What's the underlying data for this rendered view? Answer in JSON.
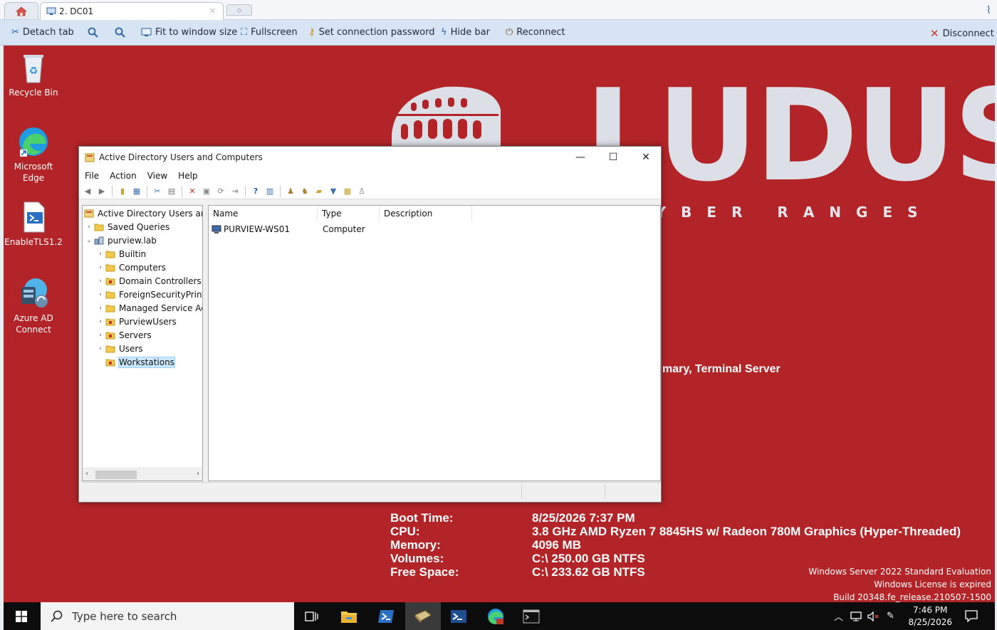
{
  "browser": {
    "tab_label": "2. DC01",
    "toolbar": {
      "detach": "Detach tab",
      "fit": "Fit to window size",
      "fullscreen": "Fullscreen",
      "password": "Set connection password",
      "hide": "Hide bar",
      "reconnect": "Reconnect",
      "disconnect": "Disconnect"
    }
  },
  "desktop": {
    "icons": [
      {
        "label": "Recycle Bin"
      },
      {
        "label": "Microsoft Edge"
      },
      {
        "label": "EnableTLS1.2"
      },
      {
        "label": "Azure AD Connect"
      }
    ],
    "logo_text": "LUDUS",
    "logo_sub": "CYBER RANGES",
    "partial_text": "mary, Terminal Server",
    "bginfo": [
      {
        "key": "Boot Time:",
        "value": "8/25/2026 7:37 PM"
      },
      {
        "key": "CPU:",
        "value": "3.8 GHz AMD Ryzen 7 8845HS w/ Radeon 780M Graphics (Hyper-Threaded)"
      },
      {
        "key": "Memory:",
        "value": "4096 MB"
      },
      {
        "key": "Volumes:",
        "value": "C:\\ 250.00 GB NTFS"
      },
      {
        "key": "Free Space:",
        "value": "C:\\ 233.62 GB NTFS"
      }
    ],
    "watermark": {
      "line1": "Windows Server 2022 Standard Evaluation",
      "line2": "Windows License is expired",
      "line3": "Build 20348.fe_release.210507-1500"
    }
  },
  "aduc": {
    "title": "Active Directory Users and Computers",
    "menu": [
      "File",
      "Action",
      "View",
      "Help"
    ],
    "tree": {
      "root": "Active Directory Users and C",
      "saved": "Saved Queries",
      "domain": "purview.lab",
      "children": [
        "Builtin",
        "Computers",
        "Domain Controllers",
        "ForeignSecurityPrincip",
        "Managed Service Acc",
        "PurviewUsers",
        "Servers",
        "Users",
        "Workstations"
      ]
    },
    "columns": [
      "Name",
      "Type",
      "Description"
    ],
    "rows": [
      {
        "name": "PURVIEW-WS01",
        "type": "Computer",
        "description": ""
      }
    ]
  },
  "taskbar": {
    "search_placeholder": "Type here to search",
    "time": "7:46 PM",
    "date": "8/25/2026"
  },
  "colors": {
    "desktop_bg": "#b22427",
    "toolbar_bg": "#d6e4f3",
    "accent": "#2d5f9e"
  }
}
